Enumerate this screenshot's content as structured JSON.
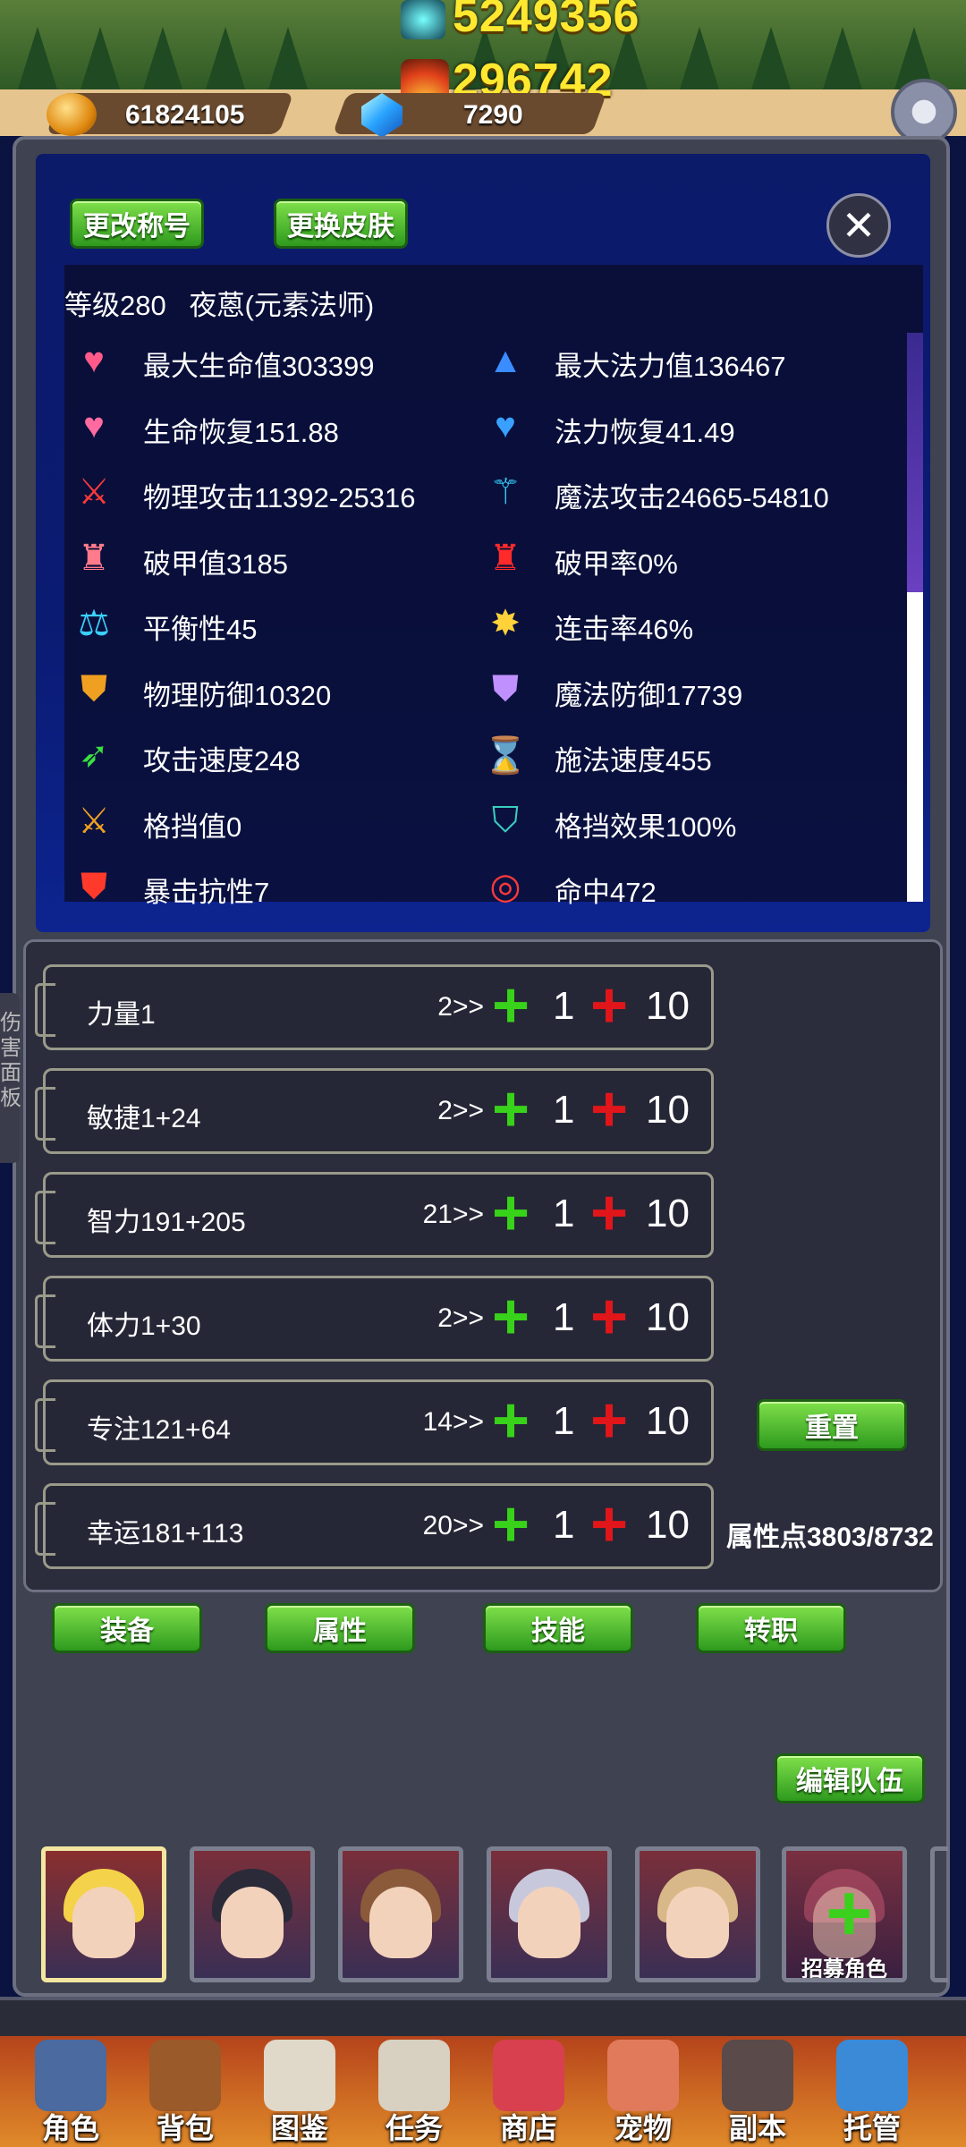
{
  "header": {
    "power_value": "5249356",
    "flame_value": "296742",
    "gold_amount": "61824105",
    "gem_amount": "7290"
  },
  "character": {
    "change_title_label": "更改称号",
    "change_skin_label": "更换皮肤",
    "level_name": "等级280   夜蒽(元素法师)"
  },
  "stats": [
    {
      "label": "最大生命值303399",
      "icon": "heart-icon"
    },
    {
      "label": "最大法力值136467",
      "icon": "wizard-hat-icon"
    },
    {
      "label": "生命恢复151.88",
      "icon": "hp-regen-icon"
    },
    {
      "label": "法力恢复41.49",
      "icon": "mp-regen-icon"
    },
    {
      "label": "物理攻击11392-25316",
      "icon": "sword-icon"
    },
    {
      "label": "魔法攻击24665-54810",
      "icon": "staff-icon"
    },
    {
      "label": "破甲值3185",
      "icon": "armor-break-icon"
    },
    {
      "label": "破甲率0%",
      "icon": "armor-break-rate-icon"
    },
    {
      "label": "平衡性45",
      "icon": "balance-icon"
    },
    {
      "label": "连击率46%",
      "icon": "star-burst-icon"
    },
    {
      "label": "物理防御10320",
      "icon": "shield-icon"
    },
    {
      "label": "魔法防御17739",
      "icon": "magic-shield-icon"
    },
    {
      "label": "攻击速度248",
      "icon": "speed-icon"
    },
    {
      "label": "施法速度455",
      "icon": "hourglass-icon"
    },
    {
      "label": "格挡值0",
      "icon": "block-icon"
    },
    {
      "label": "格挡效果100%",
      "icon": "block-effect-icon"
    },
    {
      "label": "暴击抗性7",
      "icon": "crit-resist-icon"
    },
    {
      "label": "命中472",
      "icon": "target-icon"
    }
  ],
  "side_tab_label": "伤害面板",
  "attributes": [
    {
      "name": "力量1",
      "level": "2>>"
    },
    {
      "name": "敏捷1+24",
      "level": "2>>"
    },
    {
      "name": "智力191+205",
      "level": "21>>"
    },
    {
      "name": "体力1+30",
      "level": "2>>"
    },
    {
      "name": "专注121+64",
      "level": "14>>"
    },
    {
      "name": "幸运181+113",
      "level": "20>>"
    }
  ],
  "plus_one": "1",
  "plus_ten": "10",
  "reset_label": "重置",
  "attribute_points": "属性点3803/8732",
  "tabs": [
    "装备",
    "属性",
    "技能",
    "转职"
  ],
  "edit_team_label": "编辑队伍",
  "recruit_label": "招募角色",
  "nav": [
    "角色",
    "背包",
    "图鉴",
    "任务",
    "商店",
    "宠物",
    "副本",
    "托管"
  ],
  "colors": {
    "green_button": "#3fb52a",
    "plus_green": "#38d21a",
    "plus_red": "#e0161b",
    "gold_text": "#ffe830"
  }
}
